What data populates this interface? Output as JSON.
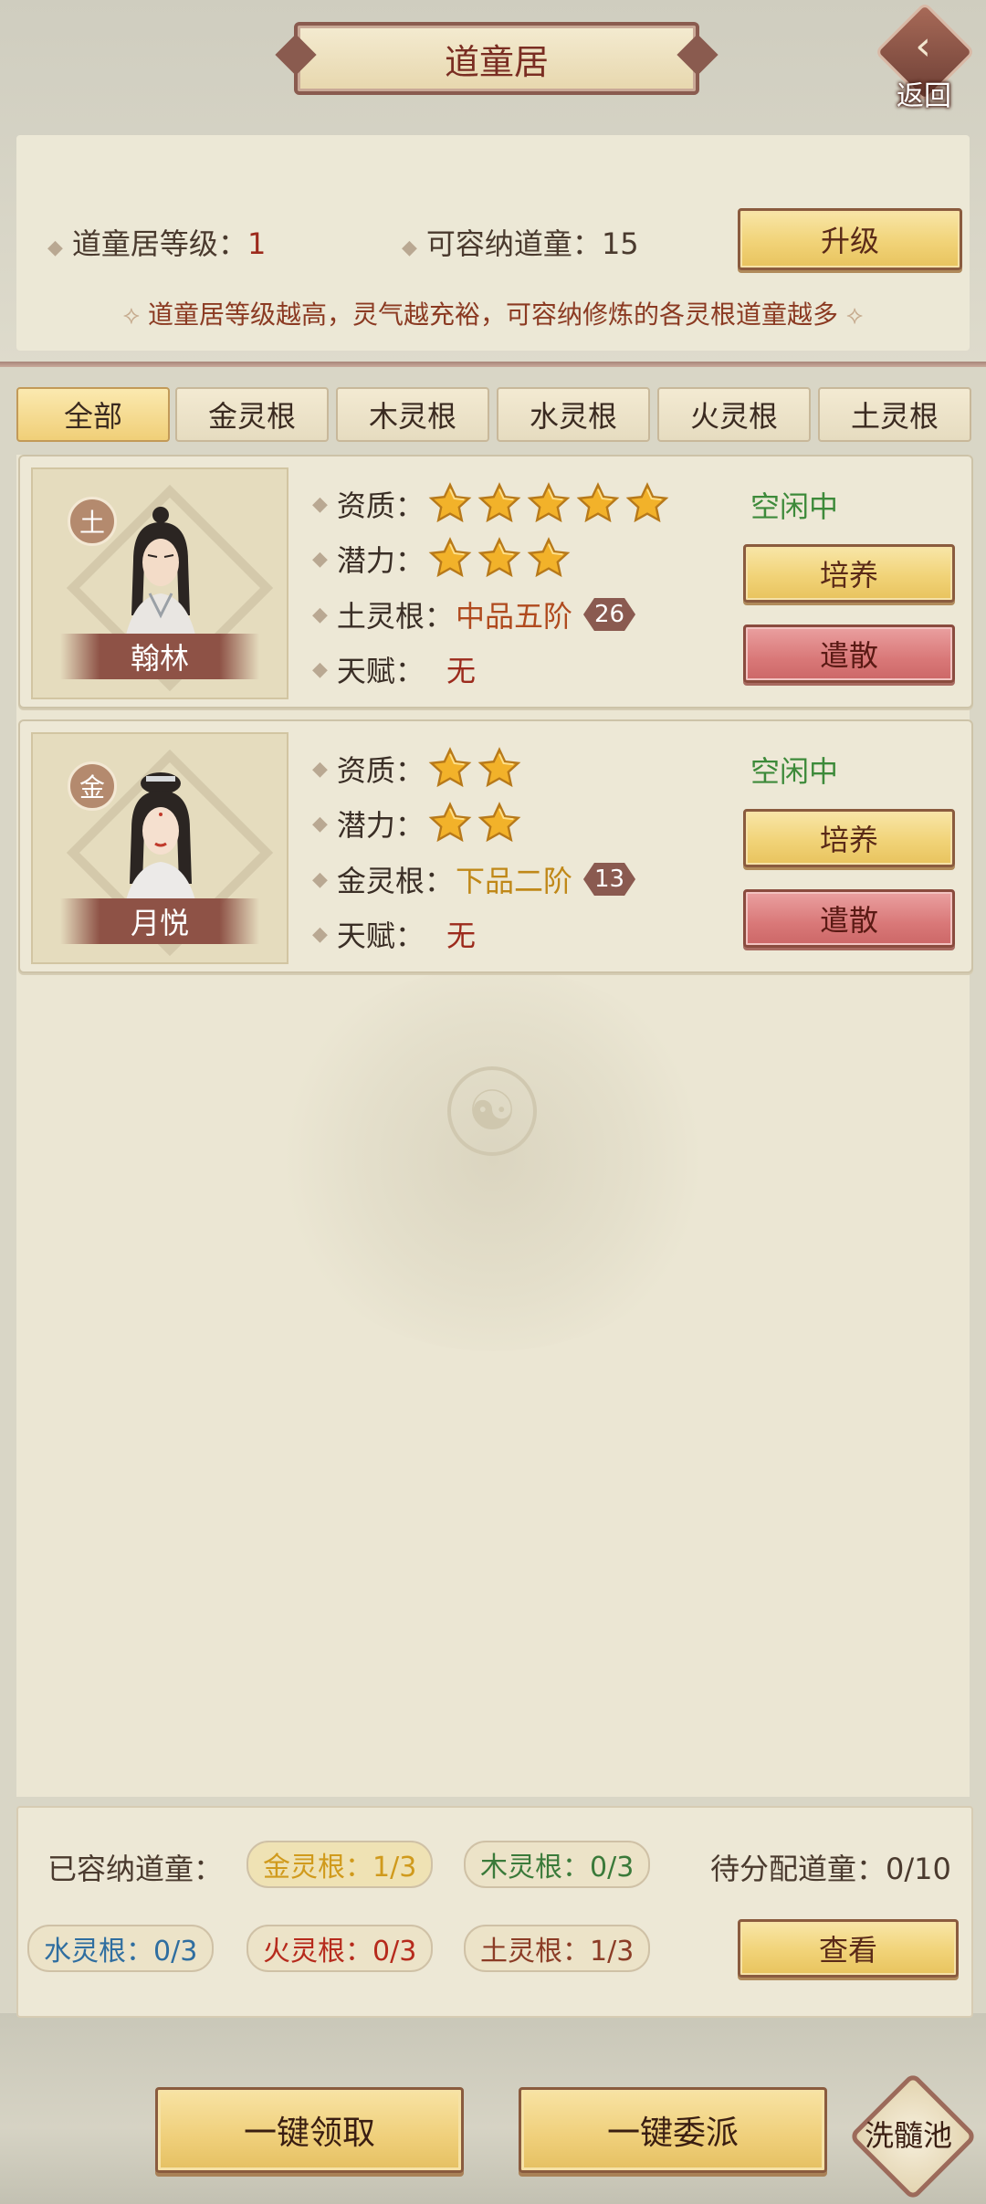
{
  "header": {
    "title": "道童居",
    "back_label": "返回"
  },
  "info": {
    "level_label": "道童居等级：",
    "level_value": "1",
    "capacity_label": "可容纳道童：",
    "capacity_value": "15",
    "upgrade_button": "升级",
    "note": "道童居等级越高，灵气越充裕，可容纳修炼的各灵根道童越多"
  },
  "tabs": [
    "全部",
    "金灵根",
    "木灵根",
    "水灵根",
    "火灵根",
    "土灵根"
  ],
  "attr_labels": {
    "aptitude": "资质：",
    "potential": "潜力：",
    "talent": "天赋："
  },
  "buttons": {
    "cultivate": "培养",
    "dismiss": "遣散"
  },
  "disciples": [
    {
      "name": "翰林",
      "element_badge": "土",
      "aptitude_stars": 5,
      "potential_stars": 3,
      "root_label": "土灵根：",
      "root_value": "中品五阶",
      "root_level": "26",
      "talent": "无",
      "status": "空闲中"
    },
    {
      "name": "月悦",
      "element_badge": "金",
      "aptitude_stars": 2,
      "potential_stars": 2,
      "root_label": "金灵根：",
      "root_value": "下品二阶",
      "root_level": "13",
      "talent": "无",
      "status": "空闲中"
    }
  ],
  "summary": {
    "housed_label": "已容纳道童：",
    "metal": "金灵根：1/3",
    "wood": "木灵根：0/3",
    "pending": "待分配道童：0/10",
    "water": "水灵根：0/3",
    "fire": "火灵根：0/3",
    "earth": "土灵根：1/3",
    "view_button": "查看"
  },
  "footer": {
    "claim_all": "一键领取",
    "assign_all": "一键委派",
    "pool": "洗髓池"
  },
  "colors": {
    "status_green": "#3d8a3a",
    "accent_red": "#9c2a1c",
    "gold": "#f1d378"
  }
}
